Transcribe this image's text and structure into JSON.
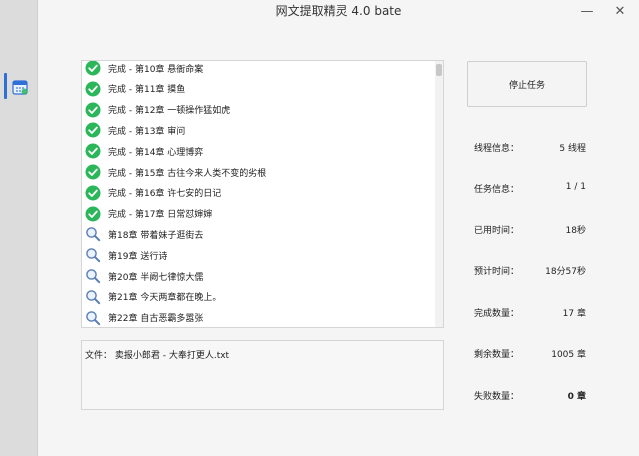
{
  "window": {
    "title": "网文提取精灵 4.0 bate",
    "minimize_icon": "minimize-icon",
    "close_icon": "close-icon"
  },
  "sidebar": {
    "active_icon": "calendar-app-icon"
  },
  "chapter_list": {
    "items": [
      {
        "status": "done",
        "icon": "check-circle-icon",
        "text": "完成  -  第10章 悬衙命案"
      },
      {
        "status": "done",
        "icon": "check-circle-icon",
        "text": "完成  -  第11章 摸鱼"
      },
      {
        "status": "done",
        "icon": "check-circle-icon",
        "text": "完成  -  第12章 一顿操作猛如虎"
      },
      {
        "status": "done",
        "icon": "check-circle-icon",
        "text": "完成  -  第13章 审问"
      },
      {
        "status": "done",
        "icon": "check-circle-icon",
        "text": "完成  -  第14章 心理博弈"
      },
      {
        "status": "done",
        "icon": "check-circle-icon",
        "text": "完成  -  第15章 古往今来人类不变的劣根"
      },
      {
        "status": "done",
        "icon": "check-circle-icon",
        "text": "完成  -  第16章 许七安的日记"
      },
      {
        "status": "done",
        "icon": "check-circle-icon",
        "text": "完成  -  第17章 日常怼婶婶"
      },
      {
        "status": "pending",
        "icon": "search-icon",
        "text": "第18章 带着妹子逛街去"
      },
      {
        "status": "pending",
        "icon": "search-icon",
        "text": "第19章 送行诗"
      },
      {
        "status": "pending",
        "icon": "search-icon",
        "text": "第20章 半阙七律惊大儒"
      },
      {
        "status": "pending",
        "icon": "search-icon",
        "text": "第21章 今天两章都在晚上。"
      },
      {
        "status": "pending",
        "icon": "search-icon",
        "text": "第22章 自古恶霸多嚣张"
      }
    ]
  },
  "file_panel": {
    "text": "文件：  卖报小郎君 - 大奉打更人.txt"
  },
  "controls": {
    "stop_label": "停止任务"
  },
  "stats": [
    {
      "label": "线程信息：",
      "value": "5 线程",
      "bold": false
    },
    {
      "label": "任务信息：",
      "value": "1 / 1",
      "bold": false
    },
    {
      "label": "已用时间：",
      "value": "18秒",
      "bold": false
    },
    {
      "label": "预计时间：",
      "value": "18分57秒",
      "bold": false
    },
    {
      "label": "完成数量：",
      "value": "17 章",
      "bold": false
    },
    {
      "label": "剩余数量：",
      "value": "1005 章",
      "bold": false
    },
    {
      "label": "失败数量：",
      "value": "0 章",
      "bold": true
    }
  ],
  "colors": {
    "success": "#2bb65a",
    "accent": "#2f6fd8"
  }
}
